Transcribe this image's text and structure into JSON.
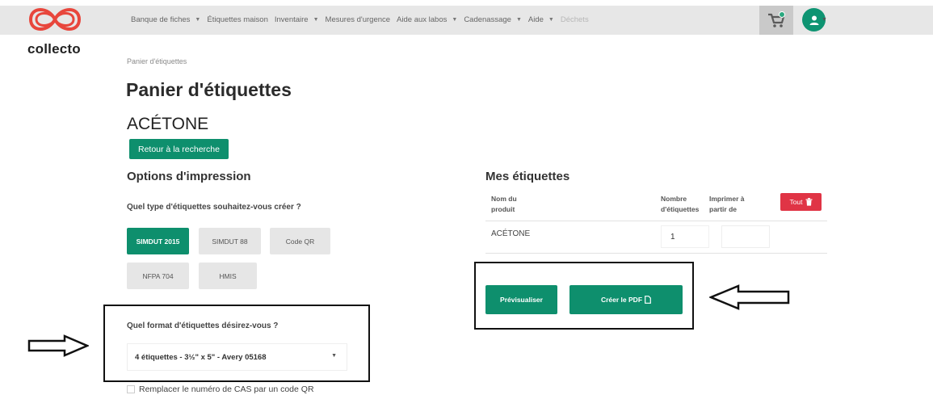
{
  "header": {
    "brand": "collecto",
    "nav": [
      {
        "label": "Banque de fiches",
        "dropdown": true,
        "muted": false
      },
      {
        "label": "Étiquettes maison",
        "dropdown": false,
        "muted": false
      },
      {
        "label": "Inventaire",
        "dropdown": true,
        "muted": false
      },
      {
        "label": "Mesures d'urgence",
        "dropdown": false,
        "muted": false
      },
      {
        "label": "Aide aux labos",
        "dropdown": true,
        "muted": false
      },
      {
        "label": "Cadenassage",
        "dropdown": true,
        "muted": false
      },
      {
        "label": "Aide",
        "dropdown": true,
        "muted": false
      },
      {
        "label": "Déchets",
        "dropdown": false,
        "muted": true
      }
    ],
    "cart_icon": "cart-icon",
    "user_icon": "user-icon"
  },
  "breadcrumb": "Panier d'étiquettes",
  "page_title": "Panier d'étiquettes",
  "product_title": "ACÉTONE",
  "back_button": "Retour à la recherche",
  "options": {
    "heading": "Options d'impression",
    "type_question": "Quel type d'étiquettes souhaitez-vous créer ?",
    "types": [
      "SIMDUT 2015",
      "SIMDUT 88",
      "Code QR",
      "NFPA 704",
      "HMIS"
    ],
    "selected_type": "SIMDUT 2015",
    "format_question": "Quel format d'étiquettes désirez-vous ?",
    "format_value": "4 étiquettes - 3½\" x 5\" - Avery 05168",
    "qr_checkbox": "Remplacer le numéro de CAS par un code QR"
  },
  "labels": {
    "heading": "Mes étiquettes",
    "col_name": "Nom du produit",
    "col_count": "Nombre d'étiquettes",
    "col_start": "Imprimer à partir de",
    "clear_button": "Tout",
    "rows": [
      {
        "name": "ACÉTONE",
        "count": "1",
        "start": ""
      }
    ],
    "preview_button": "Prévisualiser",
    "pdf_button": "Créer le PDF"
  },
  "colors": {
    "accent": "#0e8f6d",
    "danger": "#e03445",
    "logo": "#e8463c"
  }
}
